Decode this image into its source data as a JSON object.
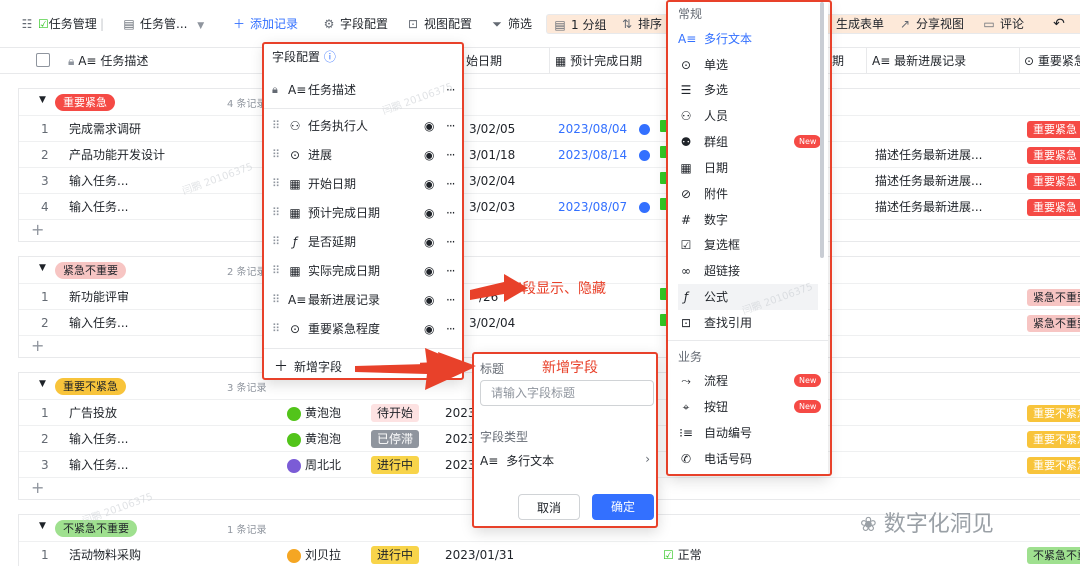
{
  "toolbar": {
    "table_name": "任务管理",
    "view_name": "任务管...",
    "add_record": "添加记录",
    "field_config": "字段配置",
    "view_config": "视图配置",
    "filter": "筛选",
    "group": "1 分组",
    "sort": "排序",
    "gen_form": "生成表单",
    "share_view": "分享视图",
    "comment": "评论"
  },
  "columns": {
    "task_desc": "任务描述",
    "start_date": "始日期",
    "expected_finish": "预计完成日期",
    "hidden_col": "期",
    "latest_progress": "最新进展记录",
    "urgency": "重要紧急"
  },
  "groups": [
    {
      "label": "重要紧急",
      "count": "4 条记录",
      "color": "#f54a45",
      "rows": [
        {
          "no": "1",
          "desc": "完成需求调研",
          "start": "3/02/05",
          "expected": "2023/08/04",
          "progress": "",
          "urg": "重要紧急"
        },
        {
          "no": "2",
          "desc": "产品功能开发设计",
          "start": "3/01/18",
          "expected": "2023/08/14",
          "progress": "描述任务最新进展...",
          "urg": "重要紧急"
        },
        {
          "no": "3",
          "desc": "输入任务...",
          "start": "3/02/04",
          "expected": "",
          "progress": "描述任务最新进展...",
          "urg": "重要紧急"
        },
        {
          "no": "4",
          "desc": "输入任务...",
          "start": "3/02/03",
          "expected": "2023/08/07",
          "progress": "描述任务最新进展...",
          "urg": "重要紧急"
        }
      ]
    },
    {
      "label": "紧急不重要",
      "count": "2 条记录",
      "color": "#f7c5c3",
      "rows": [
        {
          "no": "1",
          "desc": "新功能评审",
          "start": "/26",
          "urg": "紧急不重要"
        },
        {
          "no": "2",
          "desc": "输入任务...",
          "start": "3/02/04",
          "urg": "紧急不重要"
        }
      ]
    },
    {
      "label": "重要不紧急",
      "count": "3 条记录",
      "color": "#f8c43b",
      "rows": [
        {
          "no": "1",
          "desc": "广告投放",
          "owner": "黄泡泡",
          "status": "待开始",
          "start": "2023",
          "urg": "重要不紧急"
        },
        {
          "no": "2",
          "desc": "输入任务...",
          "owner": "黄泡泡",
          "status": "已停滞",
          "start": "2023",
          "urg": "重要不紧急"
        },
        {
          "no": "3",
          "desc": "输入任务...",
          "owner": "周北北",
          "status": "进行中",
          "start": "2023",
          "urg": "重要不紧急"
        }
      ]
    },
    {
      "label": "不紧急不重要",
      "count": "1 条记录",
      "color": "#9fe08f",
      "rows": [
        {
          "no": "1",
          "desc": "活动物料采购",
          "owner": "刘贝拉",
          "status": "进行中",
          "start": "2023/01/31",
          "delay": "正常",
          "urg": "不紧急不重要"
        }
      ]
    }
  ],
  "field_config": {
    "title": "字段配置",
    "locked_field": "任务描述",
    "fields": [
      "任务执行人",
      "进展",
      "开始日期",
      "预计完成日期",
      "是否延期",
      "实际完成日期",
      "最新进展记录",
      "重要紧急程度"
    ],
    "add_field": "新增字段"
  },
  "type_list": {
    "common_header": "常规",
    "common": [
      "多行文本",
      "单选",
      "多选",
      "人员",
      "群组",
      "日期",
      "附件",
      "数字",
      "复选框",
      "超链接",
      "公式",
      "查找引用"
    ],
    "business_header": "业务",
    "business": [
      "流程",
      "按钮",
      "自动编号",
      "电话号码"
    ],
    "new_badge": "New"
  },
  "new_field": {
    "title_label": "标题",
    "title_placeholder": "请输入字段标题",
    "type_label": "字段类型",
    "type_value": "多行文本",
    "cancel": "取消",
    "ok": "确定"
  },
  "annotations": {
    "show_hide": "字段显示、隐藏",
    "new_field": "新增字段",
    "brand": "数字化洞见"
  },
  "watermark": "闫鹏 20106375"
}
